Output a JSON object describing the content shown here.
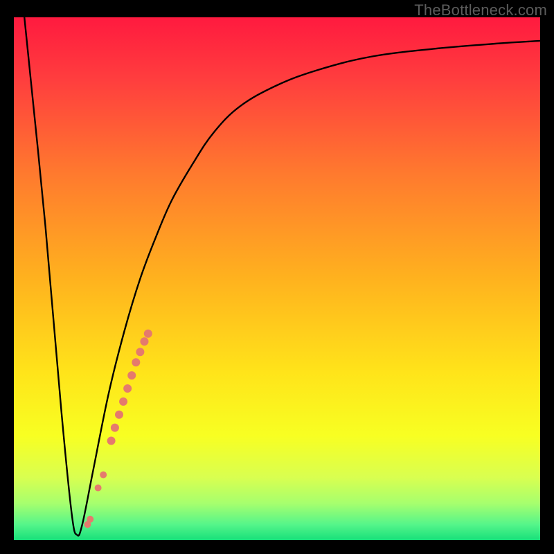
{
  "watermark": "TheBottleneck.com",
  "gradient": {
    "stops": [
      {
        "offset": 0.0,
        "color": "#ff1a3f"
      },
      {
        "offset": 0.12,
        "color": "#ff3e3e"
      },
      {
        "offset": 0.3,
        "color": "#ff7a2e"
      },
      {
        "offset": 0.5,
        "color": "#ffb21e"
      },
      {
        "offset": 0.68,
        "color": "#ffe41a"
      },
      {
        "offset": 0.8,
        "color": "#f8ff22"
      },
      {
        "offset": 0.88,
        "color": "#d9ff50"
      },
      {
        "offset": 0.93,
        "color": "#a6ff6e"
      },
      {
        "offset": 0.97,
        "color": "#55f58a"
      },
      {
        "offset": 1.0,
        "color": "#17e07a"
      }
    ]
  },
  "chart_data": {
    "type": "line",
    "title": "",
    "xlabel": "",
    "ylabel": "",
    "xlim": [
      0,
      100
    ],
    "ylim": [
      0,
      100
    ],
    "series": [
      {
        "name": "curve",
        "x": [
          2,
          6,
          9,
          11,
          12,
          13,
          15,
          18,
          21,
          24,
          27,
          30,
          34,
          38,
          43,
          50,
          58,
          68,
          80,
          92,
          100
        ],
        "y": [
          100,
          60,
          25,
          5,
          1,
          3,
          13,
          28,
          40,
          50,
          58,
          65,
          72,
          78,
          83,
          87,
          90,
          92.5,
          94,
          95,
          95.5
        ],
        "color": "#000000",
        "stroke_width": 2.4
      }
    ],
    "markers": {
      "name": "dots",
      "color": "#e57a6d",
      "points": [
        {
          "x": 14.0,
          "y": 3.0,
          "r": 5
        },
        {
          "x": 14.5,
          "y": 4.0,
          "r": 5
        },
        {
          "x": 16.0,
          "y": 10.0,
          "r": 5
        },
        {
          "x": 17.0,
          "y": 12.5,
          "r": 5
        },
        {
          "x": 18.5,
          "y": 19.0,
          "r": 6
        },
        {
          "x": 19.2,
          "y": 21.5,
          "r": 6
        },
        {
          "x": 20.0,
          "y": 24.0,
          "r": 6
        },
        {
          "x": 20.8,
          "y": 26.5,
          "r": 6
        },
        {
          "x": 21.6,
          "y": 29.0,
          "r": 6
        },
        {
          "x": 22.4,
          "y": 31.5,
          "r": 6
        },
        {
          "x": 23.2,
          "y": 34.0,
          "r": 6
        },
        {
          "x": 24.0,
          "y": 36.0,
          "r": 6
        },
        {
          "x": 24.8,
          "y": 38.0,
          "r": 6
        },
        {
          "x": 25.5,
          "y": 39.5,
          "r": 6
        }
      ]
    }
  }
}
